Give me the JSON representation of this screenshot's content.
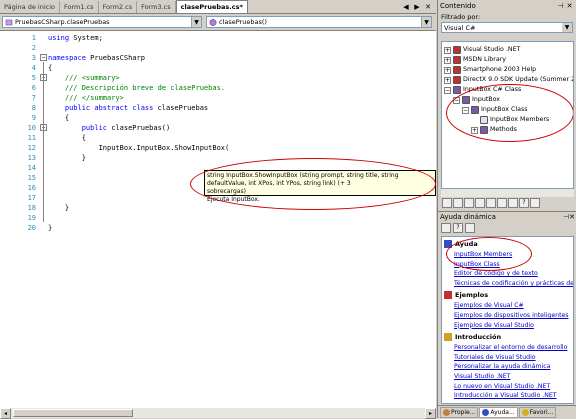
{
  "tabs": [
    {
      "label": "Página de inicio",
      "active": false
    },
    {
      "label": "Form1.cs",
      "active": false
    },
    {
      "label": "Form2.cs",
      "active": false
    },
    {
      "label": "Form3.cs",
      "active": false
    },
    {
      "label": "clasePruebas.cs*",
      "active": true
    }
  ],
  "tab_controls": {
    "left": "◀",
    "right": "▶",
    "close": "✕"
  },
  "dropdowns": {
    "type_selector": "PruebasCSharp.clasePruebas",
    "member_selector": "clasePruebas()"
  },
  "code_lines": [
    {
      "num": "1",
      "parts": [
        {
          "t": "kw",
          "s": "using"
        },
        {
          "t": "ident",
          "s": " System;"
        }
      ]
    },
    {
      "num": "2",
      "parts": []
    },
    {
      "num": "3",
      "parts": [
        {
          "t": "kw",
          "s": "namespace"
        },
        {
          "t": "ident",
          "s": " PruebasCSharp"
        }
      ],
      "fold": "-"
    },
    {
      "num": "4",
      "parts": [
        {
          "t": "ident",
          "s": "{"
        }
      ]
    },
    {
      "num": "5",
      "parts": [
        {
          "t": "cm",
          "s": "    /// <summary>"
        }
      ],
      "fold": "-"
    },
    {
      "num": "6",
      "parts": [
        {
          "t": "cm",
          "s": "    /// Descripción breve de clasePruebas."
        }
      ]
    },
    {
      "num": "7",
      "parts": [
        {
          "t": "cm",
          "s": "    /// </summary>"
        }
      ]
    },
    {
      "num": "8",
      "parts": [
        {
          "t": "kw",
          "s": "    public abstract class"
        },
        {
          "t": "ident",
          "s": " clasePruebas"
        }
      ]
    },
    {
      "num": "9",
      "parts": [
        {
          "t": "ident",
          "s": "    {"
        }
      ]
    },
    {
      "num": "10",
      "parts": [
        {
          "t": "kw",
          "s": "        public"
        },
        {
          "t": "ident",
          "s": " clasePruebas()"
        }
      ],
      "fold": "-"
    },
    {
      "num": "11",
      "parts": [
        {
          "t": "ident",
          "s": "        {"
        }
      ]
    },
    {
      "num": "12",
      "parts": [
        {
          "t": "ident",
          "s": "            InputBox.InputBox.ShowInputBox("
        }
      ]
    },
    {
      "num": "13",
      "parts": [
        {
          "t": "ident",
          "s": "        }"
        }
      ]
    },
    {
      "num": "14",
      "parts": []
    },
    {
      "num": "15",
      "parts": []
    },
    {
      "num": "16",
      "parts": []
    },
    {
      "num": "17",
      "parts": []
    },
    {
      "num": "18",
      "parts": [
        {
          "t": "ident",
          "s": "    }"
        }
      ]
    },
    {
      "num": "19",
      "parts": []
    },
    {
      "num": "20",
      "parts": [
        {
          "t": "ident",
          "s": "}"
        }
      ]
    }
  ],
  "tooltip": {
    "line1": "string InputBox.ShowInputBox (string prompt, string title, string defaultValue, int XPos, int YPos, string link) (+ 3",
    "line2": "sobrecargas)",
    "line3": "Ejecuta InputBox."
  },
  "contents_panel": {
    "title": "Contenido",
    "filter_label": "Filtrado por:",
    "filter_value": "Visual C#",
    "tree": [
      {
        "label": "Visual Studio .NET",
        "indent": 0,
        "box": "+",
        "color": "#c03030"
      },
      {
        "label": "MSDN Library",
        "indent": 0,
        "box": "+",
        "color": "#c03030"
      },
      {
        "label": "Smartphone 2003 Help",
        "indent": 0,
        "box": "+",
        "color": "#c03030"
      },
      {
        "label": "DirectX 9.0 SDK Update (Summer 2003",
        "indent": 0,
        "box": "+",
        "color": "#c03030"
      },
      {
        "label": "InputBox C# Class",
        "indent": 0,
        "box": "-",
        "color": "#7a5aa8"
      },
      {
        "label": "InputBox",
        "indent": 1,
        "box": "-",
        "color": "#7a5aa8"
      },
      {
        "label": "InputBox Class",
        "indent": 2,
        "box": "-",
        "color": "#7a5aa8"
      },
      {
        "label": "InputBox Members",
        "indent": 3,
        "box": "",
        "color": "#e0e0f0"
      },
      {
        "label": "Methods",
        "indent": 3,
        "box": "+",
        "color": "#7a5aa8"
      }
    ]
  },
  "help_panel": {
    "title": "Ayuda dinámica",
    "sections": [
      {
        "title": "Ayuda",
        "links": [
          "InputBox Members",
          "InputBox Class",
          "Editor de código y de texto",
          "Técnicas de codificación y prácticas de"
        ]
      },
      {
        "title": "Ejemplos",
        "links": [
          "Ejemplos de Visual C#",
          "Ejemplos de dispositivos inteligentes",
          "Ejemplos de Visual Studio"
        ]
      },
      {
        "title": "Introducción",
        "links": [
          "Personalizar el entorno de desarrollo",
          "Tutoriales de Visual Studio",
          "Personalizar la ayuda dinámica",
          "Visual Studio .NET",
          "Lo nuevo en Visual Studio .NET",
          "Introducción a Visual Studio .NET"
        ]
      }
    ]
  },
  "bottom_tabs": [
    {
      "label": "Propie...",
      "active": false
    },
    {
      "label": "Ayuda...",
      "active": true
    },
    {
      "label": "Favori...",
      "active": false
    }
  ],
  "colors": {
    "keyword": "#0000ff",
    "comment": "#008000",
    "highlight": "#d00000",
    "link": "#0000cc"
  }
}
